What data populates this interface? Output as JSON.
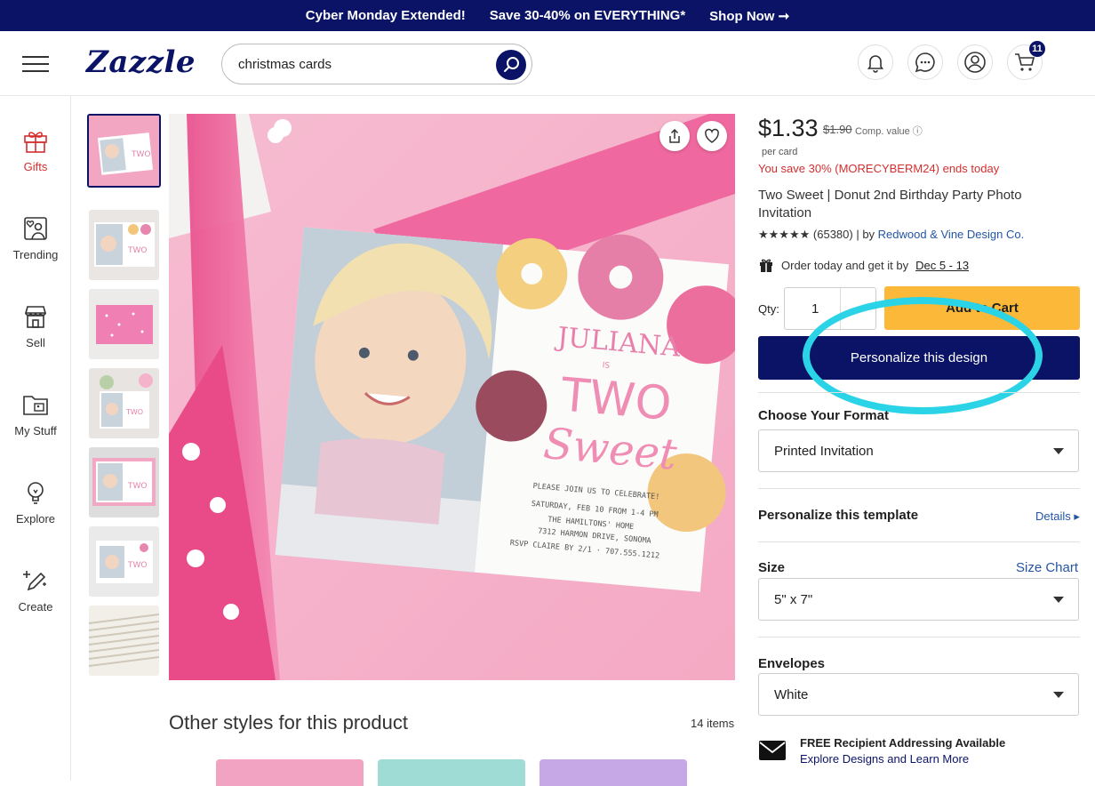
{
  "promo": {
    "text1": "Cyber Monday Extended!",
    "text2": "Save 30-40% on EVERYTHING*",
    "text3": "Shop Now ➞"
  },
  "header": {
    "logo": "Zazzle",
    "search_value": "christmas cards",
    "cart_count": "11"
  },
  "sidebar": {
    "items": [
      {
        "label": "Gifts"
      },
      {
        "label": "Trending"
      },
      {
        "label": "Sell"
      },
      {
        "label": "My Stuff"
      },
      {
        "label": "Explore"
      },
      {
        "label": "Create"
      }
    ]
  },
  "image": {
    "card_name": "JULIANA",
    "card_is": "IS",
    "card_two": "TWO",
    "card_sweet": "Sweet",
    "card_lines": [
      "PLEASE JOIN US TO CELEBRATE!",
      "SATURDAY, FEB 10 FROM 1-4 PM",
      "THE HAMILTONS' HOME",
      "7312 HARMON DRIVE, SONOMA",
      "RSVP CLAIRE BY 2/1 · 707.555.1212"
    ]
  },
  "other_styles": {
    "title": "Other styles for this product",
    "count": "14 items"
  },
  "product": {
    "price": "$1.33",
    "old_price": "$1.90",
    "comp_value": "Comp. value ⓘ",
    "per_card": "per card",
    "savings": "You save 30% (MORECYBERM24) ends today",
    "title": "Two Sweet | Donut 2nd Birthday Party Photo Invitation",
    "stars": "★★★★★",
    "reviews": "(65380) | by",
    "designer": "Redwood & Vine Design Co.",
    "order_text": "Order today and get it by",
    "order_date": "Dec 5 - 13",
    "qty_label": "Qty:",
    "qty_value": "1",
    "add_to_cart": "Add to Cart",
    "personalize_button": "Personalize this design"
  },
  "options": {
    "format_label": "Choose Your Format",
    "format_value": "Printed Invitation",
    "personalize_label": "Personalize this template",
    "details_link": "Details ▸",
    "size_label": "Size",
    "size_chart_link": "Size Chart",
    "size_value": "5\" x 7\"",
    "envelopes_label": "Envelopes",
    "envelopes_value": "White",
    "addressing_title": "FREE Recipient Addressing Available",
    "addressing_link": "Explore Designs and Learn More"
  },
  "colors": {
    "navy": "#0a1366",
    "cart_yellow": "#fbb839",
    "highlight_cyan": "#2bd3e6",
    "sale_red": "#d32f2f"
  }
}
